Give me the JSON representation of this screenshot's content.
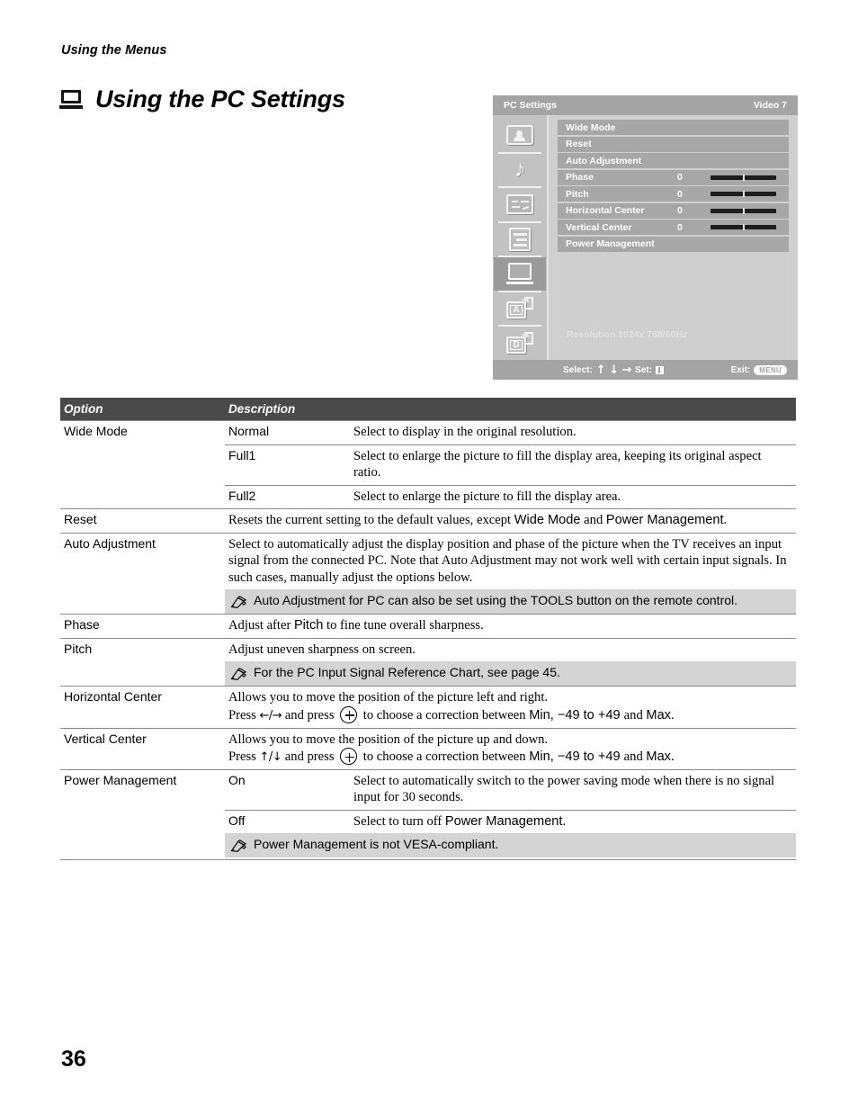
{
  "running_head": "Using the Menus",
  "page_title": "Using the PC Settings",
  "page_number": "36",
  "osd": {
    "title": "PC Settings",
    "input_label": "Video 7",
    "menu_items": [
      {
        "label": "Wide Mode",
        "value": "",
        "slider": false
      },
      {
        "label": "Reset",
        "value": "",
        "slider": false
      },
      {
        "label": "Auto Adjustment",
        "value": "",
        "slider": false
      },
      {
        "label": "Phase",
        "value": "0",
        "slider": true
      },
      {
        "label": "Pitch",
        "value": "0",
        "slider": true
      },
      {
        "label": "Horizontal Center",
        "value": "0",
        "slider": true
      },
      {
        "label": "Vertical Center",
        "value": "0",
        "slider": true
      },
      {
        "label": "Power Management",
        "value": "",
        "slider": false
      }
    ],
    "rail_icons": [
      "picture-icon",
      "sound-icon",
      "screen-icon",
      "setup-icon",
      "pc-monitor-icon",
      "analog-input-icon",
      "digital-input-icon"
    ],
    "selected_rail_icon": "pc-monitor-icon",
    "resolution": "Resolution 1024x 768/60Hz",
    "footer": {
      "select_label": "Select:",
      "select_arrows": "↑ ↓ →",
      "set_label": "Set:",
      "exit_label": "Exit:",
      "exit_key": "MENU"
    }
  },
  "table": {
    "headers": [
      "Option",
      "Description"
    ],
    "rows": [
      {
        "option": "Wide Mode",
        "subrows": [
          {
            "sub": "Normal",
            "desc": "Select to display in the original resolution."
          },
          {
            "sub": "Full1",
            "desc": "Select to enlarge the picture to fill the display area, keeping its original aspect ratio."
          },
          {
            "sub": "Full2",
            "desc": "Select to enlarge the picture to fill the display area."
          }
        ]
      },
      {
        "option": "Reset",
        "desc_pre": "Resets the current setting to the default values, except ",
        "desc_em1": "Wide Mode",
        "desc_mid": " and ",
        "desc_em2": "Power Management",
        "desc_post": "."
      },
      {
        "option": "Auto Adjustment",
        "desc": "Select to automatically adjust the display position and phase of the picture when the TV receives an input signal from the connected PC. Note that Auto Adjustment may not work well with certain input signals. In such cases, manually adjust the options below.",
        "note": "Auto Adjustment for PC can also be set using the TOOLS button on the remote control."
      },
      {
        "option": "Phase",
        "desc_pre": "Adjust after ",
        "desc_em1": "Pitch",
        "desc_post": " to fine tune overall sharpness."
      },
      {
        "option": "Pitch",
        "desc": "Adjust uneven sharpness on screen.",
        "note": "For the PC Input Signal Reference Chart, see page 45."
      },
      {
        "option": "Horizontal Center",
        "desc_line1": "Allows you to move the position of the picture left and right.",
        "press_word": "Press",
        "press_arrows": "←/→",
        "press_and": " and press ",
        "press_tail_pre": " to choose a correction between ",
        "press_min": "Min",
        "press_range": ", −49 to +49 ",
        "press_and2": "and ",
        "press_max": "Max",
        "press_end": "."
      },
      {
        "option": "Vertical Center",
        "desc_line1": "Allows you to move the position of the picture up and down.",
        "press_word": "Press",
        "press_arrows": "↑/↓",
        "press_and": " and press ",
        "press_tail_pre": " to choose a correction between ",
        "press_min": "Min",
        "press_range": ", −49 to +49 ",
        "press_and2": "and ",
        "press_max": "Max",
        "press_end": "."
      },
      {
        "option": "Power Management",
        "subrows": [
          {
            "sub": "On",
            "desc": "Select to automatically switch to the power saving mode when there is no signal input for 30 seconds."
          },
          {
            "sub": "Off",
            "desc_pre": "Select to turn off ",
            "desc_em1": "Power Management",
            "desc_post": "."
          }
        ],
        "note": "Power Management is not VESA-compliant."
      }
    ]
  },
  "colors": {
    "table_header_bg": "#4a4a4a",
    "note_bg": "#d4d4d4",
    "osd_bar_bg": "#a4a4a4",
    "osd_body_bg": "#cfcfcf",
    "osd_row_bg": "#a7a7a7"
  }
}
